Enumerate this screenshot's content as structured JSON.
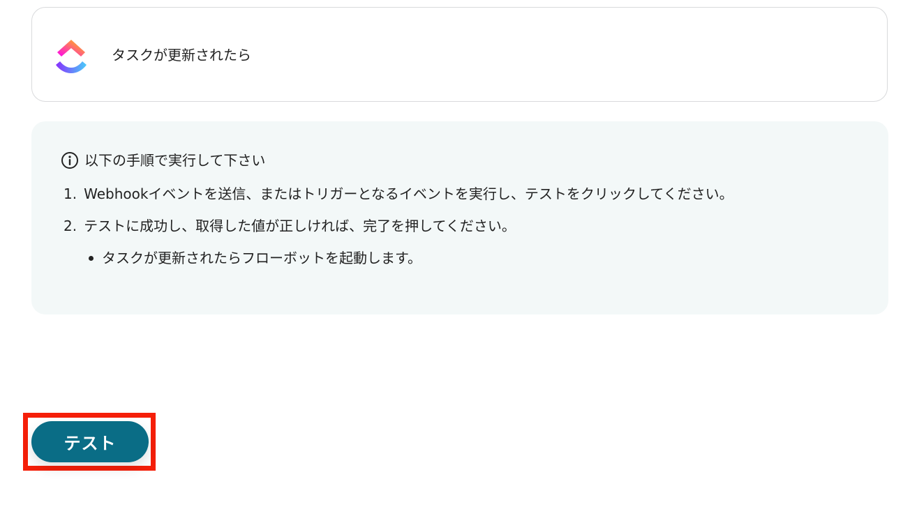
{
  "trigger": {
    "app_icon": "clickup-logo",
    "title": "タスクが更新されたら"
  },
  "instructions": {
    "icon": "info-icon",
    "heading": "以下の手順で実行して下さい",
    "steps": [
      {
        "number": "1.",
        "text": "Webhookイベントを送信、またはトリガーとなるイベントを実行し、テストをクリックしてください。"
      },
      {
        "number": "2.",
        "text": "テストに成功し、取得した値が正しければ、完了を押してください。"
      }
    ],
    "sub_items": [
      "タスクが更新されたらフローボットを起動します。"
    ]
  },
  "actions": {
    "test_label": "テスト",
    "button_color": "#0a6d86",
    "highlight_color": "#f51f09"
  }
}
